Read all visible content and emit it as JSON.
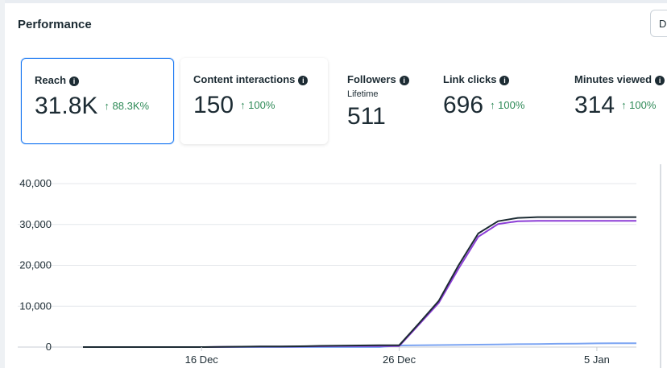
{
  "header": {
    "title": "Performance",
    "corner_button_label": "D"
  },
  "metrics": [
    {
      "label": "Reach",
      "value": "31.8K",
      "change": "↑ 88.3K%",
      "sub": ""
    },
    {
      "label": "Content interactions",
      "value": "150",
      "change": "↑ 100%",
      "sub": ""
    },
    {
      "label": "Followers",
      "value": "511",
      "change": "",
      "sub": "Lifetime"
    },
    {
      "label": "Link clicks",
      "value": "696",
      "change": "↑ 100%",
      "sub": ""
    },
    {
      "label": "Minutes viewed",
      "value": "314",
      "change": "↑ 100%",
      "sub": ""
    }
  ],
  "colors": {
    "accent": "#1877f2",
    "positive": "#2e8a57"
  },
  "chart_data": {
    "type": "line",
    "title": "",
    "xlabel": "",
    "ylabel": "",
    "x_tick_labels": [
      "16 Dec",
      "26 Dec",
      "5 Jan"
    ],
    "y_tick_labels": [
      "40,000",
      "30,000",
      "20,000",
      "10,000",
      "0"
    ],
    "ylim": [
      0,
      40000
    ],
    "grid": true,
    "x": [
      "10 Dec",
      "11 Dec",
      "12 Dec",
      "13 Dec",
      "14 Dec",
      "15 Dec",
      "16 Dec",
      "17 Dec",
      "18 Dec",
      "19 Dec",
      "20 Dec",
      "21 Dec",
      "22 Dec",
      "23 Dec",
      "24 Dec",
      "25 Dec",
      "26 Dec",
      "27 Dec",
      "28 Dec",
      "29 Dec",
      "30 Dec",
      "31 Dec",
      "1 Jan",
      "2 Jan",
      "3 Jan",
      "4 Jan",
      "5 Jan",
      "6 Jan",
      "7 Jan"
    ],
    "series": [
      {
        "color": "#1c2b33",
        "values": [
          0,
          0,
          0,
          0,
          0,
          0,
          0,
          50,
          100,
          150,
          150,
          200,
          300,
          350,
          400,
          450,
          450,
          5800,
          11300,
          20000,
          27800,
          30800,
          31600,
          31800,
          31800,
          31800,
          31800,
          31800,
          31800
        ]
      },
      {
        "color": "#8b3dd6",
        "values": [
          0,
          0,
          0,
          0,
          0,
          0,
          0,
          40,
          80,
          120,
          120,
          150,
          200,
          230,
          250,
          250,
          250,
          5500,
          10800,
          19200,
          27000,
          30100,
          30800,
          30900,
          30900,
          30900,
          30900,
          30900,
          30900
        ]
      },
      {
        "color": "#7ba4f2",
        "values": [
          0,
          0,
          0,
          0,
          0,
          0,
          0,
          0,
          0,
          0,
          0,
          0,
          0,
          0,
          0,
          0,
          400,
          450,
          500,
          550,
          600,
          650,
          700,
          750,
          800,
          850,
          900,
          950,
          950
        ]
      }
    ]
  }
}
